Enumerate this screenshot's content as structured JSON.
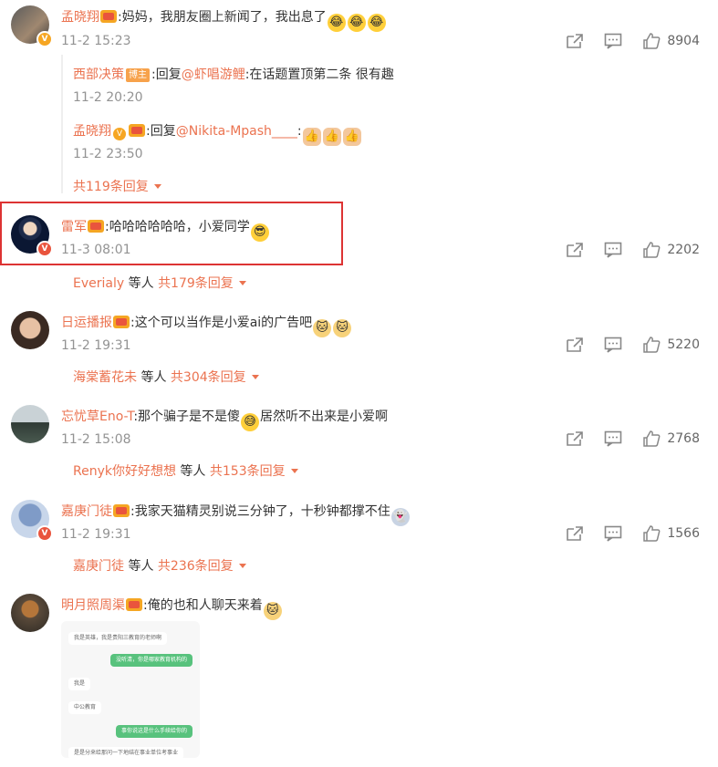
{
  "comments": [
    {
      "user": "孟晓翔",
      "text": ":妈妈，我朋友圈上新闻了，我出息了",
      "time": "11-2 15:23",
      "likes": "8904",
      "replies": [
        {
          "user": "西部决策",
          "badge": "博主",
          "prefix": ":回复",
          "mention": "@虾唱游鲤",
          "text": ":在话题置顶第二条 很有趣",
          "time": "11-2 20:20"
        },
        {
          "user": "孟晓翔",
          "prefix": ":回复",
          "mention": "@Nikita-Mpash____",
          "text": ":",
          "time": "11-2 23:50"
        }
      ],
      "more": "共119条回复"
    },
    {
      "user": "雷军",
      "text": ":哈哈哈哈哈哈，小爱同学",
      "time": "11-3 08:01",
      "likes": "2202",
      "more_user": "Everialy",
      "more_mid": " 等人 ",
      "more": "共179条回复"
    },
    {
      "user": "日运播报",
      "text": ":这个可以当作是小爱ai的广告吧",
      "time": "11-2 19:31",
      "likes": "5220",
      "more_user": "海棠蓄花未",
      "more_mid": " 等人 ",
      "more": "共304条回复"
    },
    {
      "user": "忘忧草Eno-T",
      "text": ":那个骗子是不是傻",
      "text2": "居然听不出来是小爱啊",
      "time": "11-2 15:08",
      "likes": "2768",
      "more_user": "Renyk你好好想想",
      "more_mid": " 等人 ",
      "more": "共153条回复"
    },
    {
      "user": "嘉庚门徒",
      "text": ":我家天猫精灵别说三分钟了，十秒钟都撑不住",
      "time": "11-2 19:31",
      "likes": "1566",
      "more_user": "嘉庚门徒",
      "more_mid": " 等人 ",
      "more": "共236条回复"
    },
    {
      "user": "明月照周渠",
      "text": ":俺的也和人聊天来着"
    }
  ],
  "chat_screenshot": [
    {
      "side": "left",
      "text": "我是英雄，我是贵阳三教育的老师啊"
    },
    {
      "side": "right",
      "text": "没听清，你是哪家教育机构的"
    },
    {
      "side": "left",
      "text": "我是"
    },
    {
      "side": "left",
      "text": "中公教育"
    },
    {
      "side": "right",
      "text": "事你说这是什么手续给你的"
    },
    {
      "side": "left",
      "text": "是是分来给那问一下地结在事业单位考事业"
    }
  ],
  "colors": {
    "accent": "#eb7350",
    "time": "#939393",
    "highlight": "#dd3333"
  },
  "icons": [
    "share-icon",
    "comment-icon",
    "like-icon",
    "caret-down-icon"
  ]
}
